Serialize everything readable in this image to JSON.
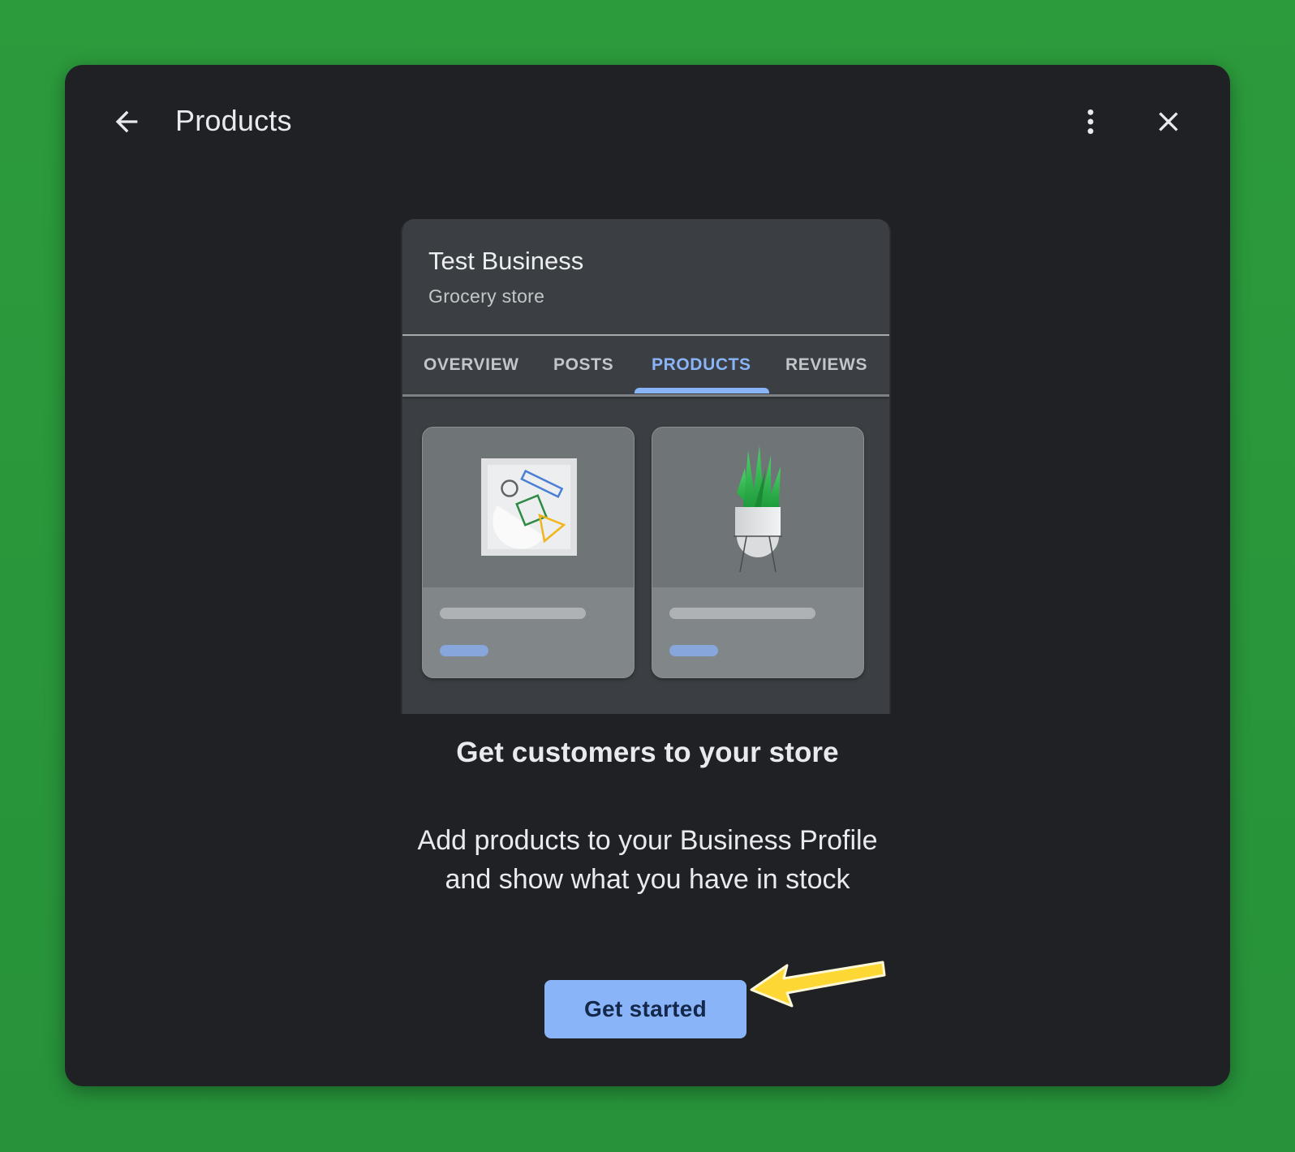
{
  "dialog": {
    "title": "Products",
    "back_icon": "arrow-left-icon",
    "more_icon": "more-vert-icon",
    "close_icon": "close-icon"
  },
  "preview": {
    "business_name": "Test Business",
    "business_category": "Grocery store",
    "tabs": [
      {
        "label": "OVERVIEW",
        "active": false
      },
      {
        "label": "POSTS",
        "active": false
      },
      {
        "label": "PRODUCTS",
        "active": true
      },
      {
        "label": "REVIEWS",
        "active": false
      }
    ],
    "products": [
      {
        "image": "abstract-shapes-illustration"
      },
      {
        "image": "potted-plant-illustration"
      }
    ]
  },
  "content": {
    "headline": "Get customers to your store",
    "description_line1": "Add products to your Business Profile",
    "description_line2": "and show what you have in stock",
    "cta_label": "Get started"
  },
  "annotation": {
    "icon": "yellow-arrow-icon",
    "color": "#fdd835"
  },
  "colors": {
    "background": "#2a9a3b",
    "dialog": "#1f2124",
    "accent": "#8ab4f8",
    "text": "#e8eaed"
  }
}
